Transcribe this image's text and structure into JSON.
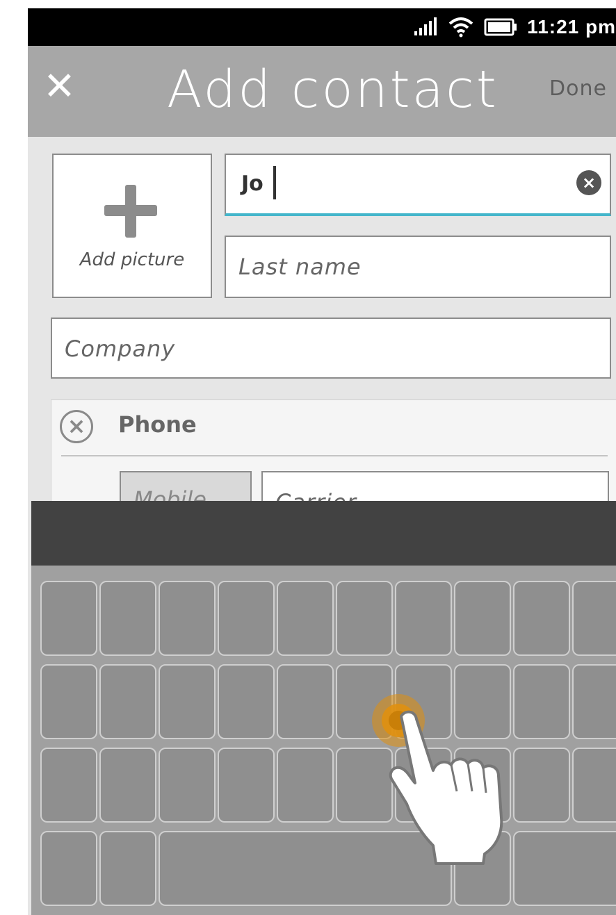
{
  "status_bar": {
    "time": "11:21 pm",
    "icons": [
      "signal-icon",
      "wifi-icon",
      "battery-icon"
    ]
  },
  "header": {
    "close_icon": "close-icon",
    "title": "Add contact",
    "done_label": "Done"
  },
  "form": {
    "add_picture_label": "Add picture",
    "first_name_value": "Jo",
    "last_name_placeholder": "Last name",
    "company_placeholder": "Company",
    "phone_section": {
      "label": "Phone",
      "type_value": "Mobile",
      "carrier_placeholder": "Carrier"
    }
  },
  "colors": {
    "accent": "#44b6cb",
    "header": "#a7a7a7",
    "touch": "#e0900f"
  }
}
